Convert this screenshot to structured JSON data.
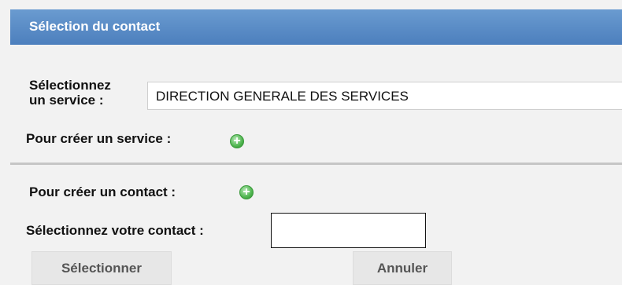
{
  "dialog": {
    "title": "Sélection du contact"
  },
  "service": {
    "label_line1": "Sélectionnez",
    "label_line2": "un service :",
    "selected": "DIRECTION GENERALE DES SERVICES",
    "create_label": "Pour créer un service :"
  },
  "contact": {
    "create_label": "Pour créer un contact :",
    "select_label": "Sélectionnez votre contact :",
    "value": ""
  },
  "buttons": {
    "select": "Sélectionner",
    "cancel": "Annuler"
  },
  "icons": {
    "add": "add-plus-icon"
  },
  "colors": {
    "titlebar": "#5a8cc8",
    "add_icon": "#4fb54f"
  }
}
